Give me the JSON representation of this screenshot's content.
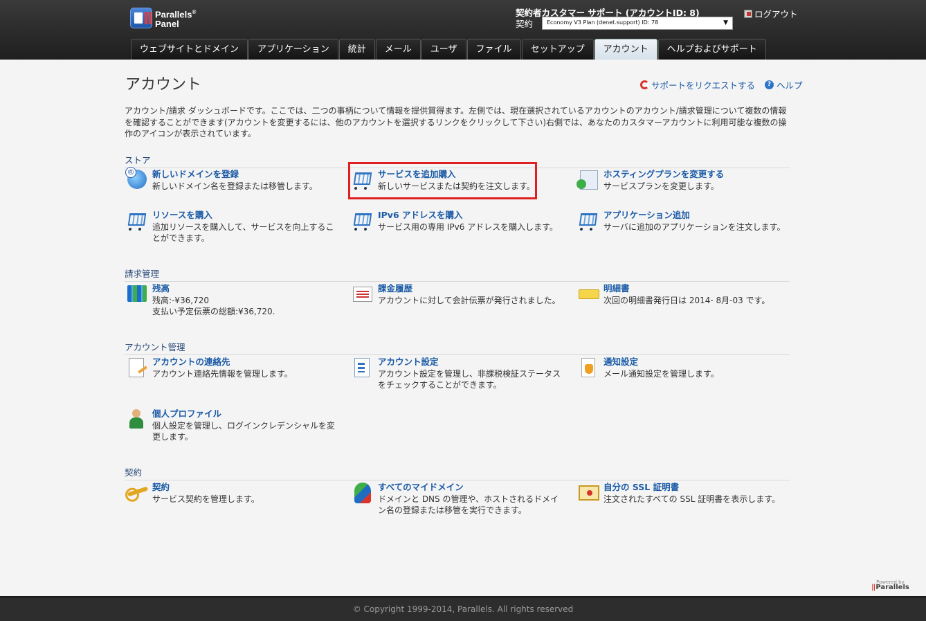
{
  "header": {
    "logo_line1": "Parallels",
    "logo_reg": "®",
    "logo_line2": "Panel",
    "owner_label": "契約者カスタマー サポート (アカウントID: 8)",
    "subscription_label": "契約",
    "subscription_value": "Economy V3 Plan (denet.support) ID: 78",
    "logout_label": "ログアウト"
  },
  "tabs": [
    {
      "label": "ウェブサイトとドメイン"
    },
    {
      "label": "アプリケーション"
    },
    {
      "label": "統計"
    },
    {
      "label": "メール"
    },
    {
      "label": "ユーザ"
    },
    {
      "label": "ファイル"
    },
    {
      "label": "セットアップ"
    },
    {
      "label": "アカウント",
      "active": true
    },
    {
      "label": "ヘルプおよびサポート"
    }
  ],
  "page": {
    "title": "アカウント",
    "support_link": "サポートをリクエストする",
    "help_link": "ヘルプ",
    "description": "アカウント/請求 ダッシュボードです。ここでは、二つの事柄について情報を提供質得ます。左側では、現在選択されているアカウントのアカウント/請求管理について複数の情報を確認することができます(アカウントを変更するには、他のアカウントを選択するリンクをクリックして下さい)右側では、あなたのカスタマーアカウントに利用可能な複数の操作のアイコンが表示されています。"
  },
  "sections": {
    "store": {
      "title": "ストア",
      "items": [
        {
          "title": "新しいドメインを登録",
          "sub": "新しいドメイン名を登録または移管します。",
          "icon": "globe-icon"
        },
        {
          "title": "サービスを追加購入",
          "sub": "新しいサービスまたは契約を注文します。",
          "icon": "cart-icon"
        },
        {
          "title": "ホスティングプランを変更する",
          "sub": "サービスプランを変更します。",
          "icon": "plan-change-icon"
        },
        {
          "title": "リソースを購入",
          "sub": "追加リソースを購入して、サービスを向上することができます。",
          "icon": "cart-icon"
        },
        {
          "title": "IPv6 アドレスを購入",
          "sub": "サービス用の専用 IPv6 アドレスを購入します。",
          "icon": "cart-icon"
        },
        {
          "title": "アプリケーション追加",
          "sub": "サーバに追加のアプリケーションを注文します。",
          "icon": "cart-icon"
        }
      ]
    },
    "billing": {
      "title": "請求管理",
      "items": [
        {
          "title": "残高",
          "sub1": "残高:-¥36,720",
          "sub2": "支払い予定伝票の総額:¥36,720.",
          "icon": "books-icon"
        },
        {
          "title": "課金履歴",
          "sub": "アカウントに対して会計伝票が発行されました。",
          "icon": "invoice-icon"
        },
        {
          "title": "明細書",
          "sub": "次回の明細書発行日は 2014- 8月-03 です。",
          "icon": "statement-icon"
        }
      ]
    },
    "account": {
      "title": "アカウント管理",
      "items": [
        {
          "title": "アカウントの連絡先",
          "sub": "アカウント連絡先情報を管理します。",
          "icon": "contact-icon"
        },
        {
          "title": "アカウント設定",
          "sub": "アカウント設定を管理し、非課税検証ステータスをチェックすることができます。",
          "icon": "settings-icon"
        },
        {
          "title": "通知設定",
          "sub": "メール通知設定を管理します。",
          "icon": "notification-icon"
        },
        {
          "title": "個人プロファイル",
          "sub": "個人設定を管理し、ログインクレデンシャルを変更します。",
          "icon": "profile-icon"
        }
      ]
    },
    "subscription": {
      "title": "契約",
      "items": [
        {
          "title": "契約",
          "sub": "サービス契約を管理します。",
          "icon": "key-icon"
        },
        {
          "title": "すべてのマイドメイン",
          "sub": "ドメインと DNS の管理や、ホストされるドメイン名の登録または移管を実行できます。",
          "icon": "domains-icon"
        },
        {
          "title": "自分の SSL 証明書",
          "sub": "注文されたすべての SSL 証明書を表示します。",
          "icon": "certificate-icon"
        }
      ]
    }
  },
  "powered": {
    "line1": "Powered by",
    "brand": "Parallels"
  },
  "footer": {
    "copyright": "© Copyright 1999-2014, Parallels. All rights reserved"
  }
}
